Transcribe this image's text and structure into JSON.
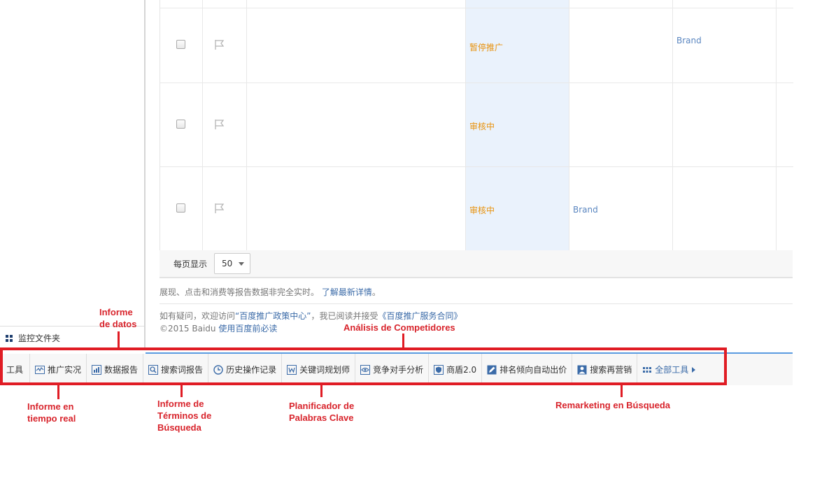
{
  "sidebar": {
    "folder_label": "监控文件夹",
    "folder_icon": "grid-icon"
  },
  "table": {
    "rows": [
      {
        "status": "暂停推广",
        "brand_a": "",
        "brand_b": "Brand"
      },
      {
        "status": "审核中",
        "brand_a": "",
        "brand_b": ""
      },
      {
        "status": "审核中",
        "brand_a": "Brand",
        "brand_b": ""
      }
    ],
    "status_color": "#e8920c",
    "link_color": "#5a86c0"
  },
  "pager": {
    "label": "每页显示",
    "page_size": "50"
  },
  "notice": {
    "text": "展现、点击和消费等报告数据非完全实时。",
    "link": "了解最新详情",
    "tail": "。"
  },
  "footer": {
    "line1_prefix": "如有疑问，欢迎访问",
    "line1_link1": "“百度推广政策中心”",
    "line1_mid": "，我已阅读并接受",
    "line1_link2": "《百度推广服务合同》",
    "line2_copy": "©2015 Baidu ",
    "line2_link": "使用百度前必读"
  },
  "toolbar": {
    "title": "工具",
    "tools": [
      {
        "label": "推广实况",
        "icon": "realtime-chart-icon"
      },
      {
        "label": "数据报告",
        "icon": "bar-chart-icon"
      },
      {
        "label": "搜索词报告",
        "icon": "search-report-icon"
      },
      {
        "label": "历史操作记录",
        "icon": "clock-icon"
      },
      {
        "label": "关键词规划师",
        "icon": "w-doc-icon"
      },
      {
        "label": "竞争对手分析",
        "icon": "eye-icon"
      },
      {
        "label": "商盾2.0",
        "icon": "shield-icon"
      },
      {
        "label": "排名倾向自动出价",
        "icon": "edit-icon"
      },
      {
        "label": "搜索再营销",
        "icon": "person-icon"
      }
    ],
    "all_tools": "全部工具",
    "accent": "#3b6ba8"
  },
  "annotations": {
    "informe_datos": [
      "Informe",
      "de datos"
    ],
    "analisis": "Análisis de Competidores",
    "informe_tiempo": [
      "Informe en",
      "tiempo real"
    ],
    "informe_terminos": [
      "Informe de",
      "Términos de",
      "Búsqueda"
    ],
    "planificador": [
      "Planificador de",
      "Palabras Clave"
    ],
    "remarketing": "Remarketing en Búsqueda",
    "color": "#e01c24"
  }
}
